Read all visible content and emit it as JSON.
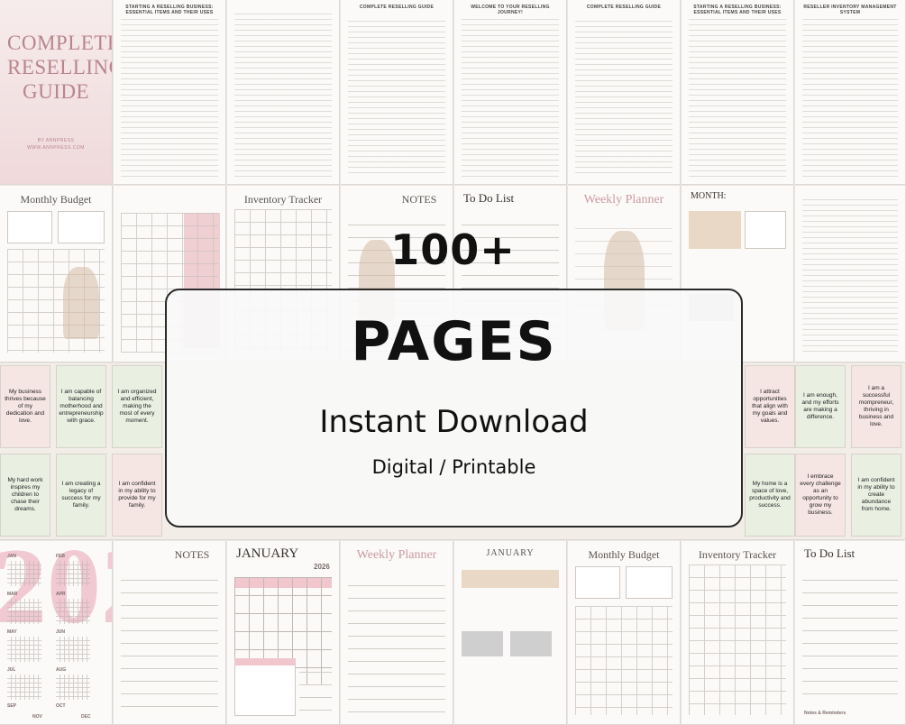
{
  "cover": {
    "title": "COMPLETE RESELLING GUIDE",
    "author": "BY ANNPRESS",
    "website": "WWW.ANNPRESS.COM"
  },
  "overlay": {
    "count": "100+",
    "pages": "PAGES",
    "instant": "Instant Download",
    "formats": "Digital / Printable"
  },
  "page_titles": {
    "monthly_budget": "Monthly Budget",
    "inventory_tracker": "Inventory Tracker",
    "notes": "NOTES",
    "todo": "To Do List",
    "weekly_planner": "Weekly Planner",
    "month": "MONTH:",
    "january": "JANUARY",
    "year": "2026"
  },
  "doc_headers": {
    "starting": "STARTING A RESELLING BUSINESS: ESSENTIAL ITEMS AND THEIR USES",
    "guide": "COMPLETE RESELLING GUIDE",
    "welcome": "WELCOME TO YOUR RESELLING JOURNEY!",
    "inventory": "RESELLER INVENTORY MANAGEMENT SYSTEM"
  },
  "affirmations": [
    "My business thrives because of my dedication and love.",
    "I am capable of balancing motherhood and entrepreneurship with grace.",
    "I am organized and efficient, making the most of every moment.",
    "I attract opportunities that align with my goals and values.",
    "I am enough, and my efforts are making a difference.",
    "I am a successful mompreneur, thriving in business and love.",
    "My hard work inspires my children to chase their dreams.",
    "I am creating a legacy of success for my family.",
    "I am confident in my ability to provide for my family.",
    "My home is a space of love, productivity and success.",
    "I embrace every challenge as an opportunity to grow my business.",
    "I am confident in my ability to create abundance from home."
  ],
  "calendar_months": [
    "JAN",
    "FEB",
    "MAR",
    "APR",
    "MAY",
    "JUN",
    "JUL",
    "AUG",
    "SEP",
    "OCT",
    "NOV",
    "DEC"
  ],
  "notes_footer": "Notes & Reminders"
}
